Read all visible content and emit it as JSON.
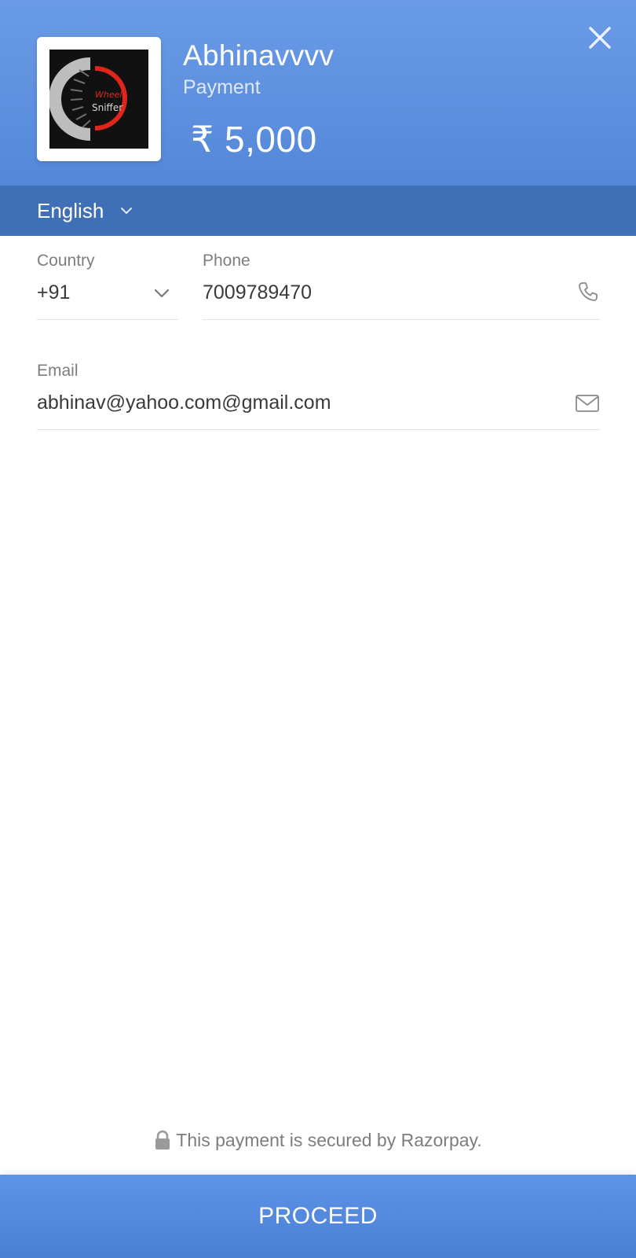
{
  "header": {
    "merchant_name": "Abhinavvvv",
    "merchant_description": "Payment",
    "amount": "₹ 5,000",
    "logo": {
      "line1": "Wheel",
      "line2": "Sniffer",
      "accent_color": "#e0261b",
      "background_color": "#111111"
    },
    "close_icon": "close-icon"
  },
  "language": {
    "selected": "English"
  },
  "form": {
    "country": {
      "label": "Country",
      "value": "+91"
    },
    "phone": {
      "label": "Phone",
      "value": "7009789470",
      "icon": "phone-icon"
    },
    "email": {
      "label": "Email",
      "value": "abhinav@yahoo.com@gmail.com",
      "icon": "mail-icon"
    }
  },
  "footer": {
    "secure_text": "This payment is secured by Razorpay.",
    "proceed_label": "PROCEED"
  },
  "colors": {
    "header_top": "#6a9be6",
    "header_bottom": "#4f82d6",
    "language_bar": "#3f6fb6",
    "button": "#5589dc"
  }
}
